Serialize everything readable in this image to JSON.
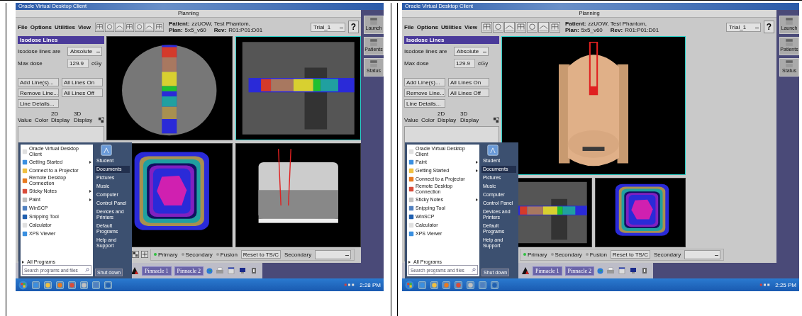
{
  "screens": [
    {
      "client_title": "Oracle Virtual Desktop Client",
      "window_title": "Planning",
      "menu": [
        "File",
        "Options",
        "Utilities",
        "View"
      ],
      "patient_label": "Patient:",
      "patient": "zzUOW, Test Phantom,",
      "plan_label": "Plan:",
      "plan": "5x5_v60",
      "rev_label": "Rev:",
      "rev": "R01:P01:D01",
      "trial": "Trial_1",
      "help": "?",
      "panel": {
        "title": "Isodose Lines",
        "mode_label": "Isodose lines are",
        "mode": "Absolute",
        "max_label": "Max dose",
        "max": "129.9",
        "unit": "cGy",
        "buttons": [
          "Add Line(s)...",
          "All Lines On",
          "Remove Line...",
          "All Lines Off",
          "Line Details..."
        ],
        "columns": [
          "Value",
          "Color",
          "2D Display",
          "3D Display"
        ]
      },
      "views": [
        {
          "kind": "axial",
          "selected": false
        },
        {
          "kind": "sagittal",
          "selected": true
        },
        {
          "kind": "coronal",
          "selected": false
        },
        {
          "kind": "drr",
          "selected": false
        }
      ],
      "radios": [
        {
          "label": "Primary",
          "selected": true
        },
        {
          "label": "Secondary",
          "selected": false
        },
        {
          "label": "Fusion",
          "selected": false
        }
      ],
      "reset": "Reset to TS/C",
      "secondary_label": "Secondary",
      "pinnacle_tabs": [
        "Pinnacle 1",
        "Pinnacle 2"
      ],
      "side_tiles": [
        "Launch",
        "Patients",
        "Status"
      ],
      "start_menu": {
        "programs": [
          {
            "label": "Oracle Virtual Desktop Client",
            "submenu": false
          },
          {
            "label": "Getting Started",
            "submenu": true
          },
          {
            "label": "Connect to a Projector",
            "submenu": false
          },
          {
            "label": "Remote Desktop Connection",
            "submenu": false
          },
          {
            "label": "Sticky Notes",
            "submenu": true
          },
          {
            "label": "Paint",
            "submenu": true
          },
          {
            "label": "WinSCP",
            "submenu": false
          },
          {
            "label": "Snipping Tool",
            "submenu": false
          },
          {
            "label": "Calculator",
            "submenu": false
          },
          {
            "label": "XPS Viewer",
            "submenu": false
          }
        ],
        "all_programs": "All Programs",
        "search_placeholder": "Search programs and files",
        "places": [
          {
            "label": "Student",
            "selected": false
          },
          {
            "label": "Documents",
            "selected": true
          },
          {
            "label": "Pictures",
            "selected": false
          },
          {
            "label": "Music",
            "selected": false
          },
          {
            "label": "Computer",
            "selected": false
          },
          {
            "label": "Control Panel",
            "selected": false
          },
          {
            "label": "Devices and Printers",
            "selected": false
          },
          {
            "label": "Default Programs",
            "selected": false
          },
          {
            "label": "Help and Support",
            "selected": false
          }
        ],
        "shutdown": "Shut down"
      },
      "clock": "2:28 PM"
    },
    {
      "client_title": "Oracle Virtual Desktop Client",
      "window_title": "Planning",
      "menu": [
        "File",
        "Options",
        "Utilities",
        "View"
      ],
      "patient_label": "Patient:",
      "patient": "zzUOW, Test Phantom,",
      "plan_label": "Plan:",
      "plan": "5x5_v60",
      "rev_label": "Rev:",
      "rev": "R01:P01:D01",
      "trial": "Trial_1",
      "help": "?",
      "panel": {
        "title": "Isodose Lines",
        "mode_label": "Isodose lines are",
        "mode": "Absolute",
        "max_label": "Max dose",
        "max": "129.9",
        "unit": "cGy",
        "buttons": [
          "Add Line(s)...",
          "All Lines On",
          "Remove Line...",
          "All Lines Off",
          "Line Details..."
        ],
        "columns": [
          "Value",
          "Color",
          "2D Display",
          "3D Display"
        ]
      },
      "views": [
        {
          "kind": "render3d",
          "selected": true
        },
        {
          "kind": "sagittal",
          "selected": false
        },
        {
          "kind": "coronal",
          "selected": false
        }
      ],
      "radios": [
        {
          "label": "Primary",
          "selected": true
        },
        {
          "label": "Secondary",
          "selected": false
        },
        {
          "label": "Fusion",
          "selected": false
        }
      ],
      "reset": "Reset to TS/C",
      "secondary_label": "Secondary",
      "pinnacle_tabs": [
        "Pinnacle 1",
        "Pinnacle 2"
      ],
      "side_tiles": [
        "Launch",
        "Patients",
        "Status"
      ],
      "start_menu": {
        "programs": [
          {
            "label": "Oracle Virtual Desktop Client",
            "submenu": false
          },
          {
            "label": "Paint",
            "submenu": true
          },
          {
            "label": "Getting Started",
            "submenu": true
          },
          {
            "label": "Connect to a Projector",
            "submenu": false
          },
          {
            "label": "Remote Desktop Connection",
            "submenu": false
          },
          {
            "label": "Sticky Notes",
            "submenu": true
          },
          {
            "label": "Snipping Tool",
            "submenu": false
          },
          {
            "label": "WinSCP",
            "submenu": false
          },
          {
            "label": "Calculator",
            "submenu": false
          },
          {
            "label": "XPS Viewer",
            "submenu": false
          }
        ],
        "all_programs": "All Programs",
        "search_placeholder": "Search programs and files",
        "places": [
          {
            "label": "Student",
            "selected": false
          },
          {
            "label": "Documents",
            "selected": true
          },
          {
            "label": "Pictures",
            "selected": false
          },
          {
            "label": "Music",
            "selected": false
          },
          {
            "label": "Computer",
            "selected": false
          },
          {
            "label": "Control Panel",
            "selected": false
          },
          {
            "label": "Devices and Printers",
            "selected": false
          },
          {
            "label": "Default Programs",
            "selected": false
          },
          {
            "label": "Help and Support",
            "selected": false
          }
        ],
        "shutdown": "Shut down"
      },
      "clock": "2:25 PM"
    }
  ]
}
